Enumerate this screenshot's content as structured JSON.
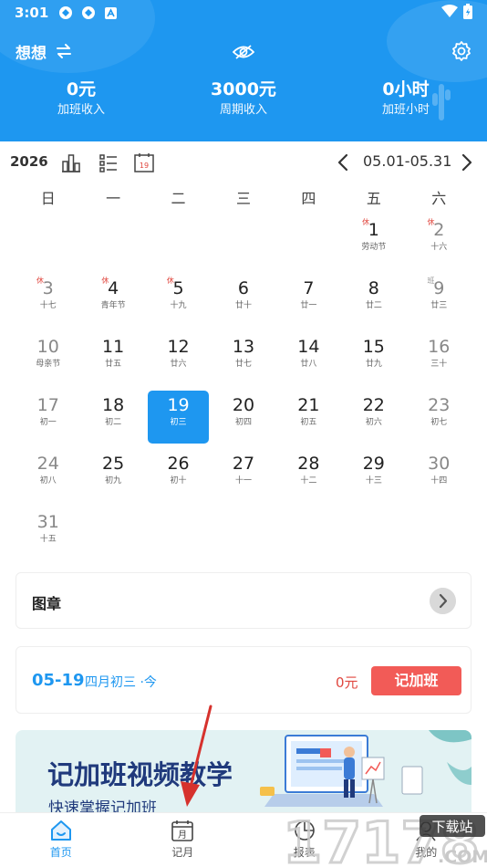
{
  "status_bar": {
    "time": "3:01"
  },
  "header": {
    "app_title": "想想",
    "stats": [
      {
        "value": "0元",
        "label": "加班收入"
      },
      {
        "value": "3000元",
        "label": "周期收入"
      },
      {
        "value": "0小时",
        "label": "加班小时"
      }
    ]
  },
  "toolbar": {
    "year": "2026",
    "range": "05.01-05.31"
  },
  "weekdays": [
    "日",
    "一",
    "二",
    "三",
    "四",
    "五",
    "六"
  ],
  "calendar": {
    "today_day": "19",
    "rows": [
      [
        {
          "day": "",
          "sub": ""
        },
        {
          "day": "",
          "sub": ""
        },
        {
          "day": "",
          "sub": ""
        },
        {
          "day": "",
          "sub": ""
        },
        {
          "day": "",
          "sub": ""
        },
        {
          "day": "1",
          "sub": "劳动节",
          "tag": "休"
        },
        {
          "day": "2",
          "sub": "十六",
          "tag": "休"
        }
      ],
      [
        {
          "day": "3",
          "sub": "十七",
          "tag": "休"
        },
        {
          "day": "4",
          "sub": "青年节",
          "tag": "休"
        },
        {
          "day": "5",
          "sub": "十九",
          "tag": "休"
        },
        {
          "day": "6",
          "sub": "廿十"
        },
        {
          "day": "7",
          "sub": "廿一"
        },
        {
          "day": "8",
          "sub": "廿二"
        },
        {
          "day": "9",
          "sub": "廿三",
          "tag": "班"
        }
      ],
      [
        {
          "day": "10",
          "sub": "母亲节"
        },
        {
          "day": "11",
          "sub": "廿五"
        },
        {
          "day": "12",
          "sub": "廿六"
        },
        {
          "day": "13",
          "sub": "廿七"
        },
        {
          "day": "14",
          "sub": "廿八"
        },
        {
          "day": "15",
          "sub": "廿九"
        },
        {
          "day": "16",
          "sub": "三十"
        }
      ],
      [
        {
          "day": "17",
          "sub": "初一"
        },
        {
          "day": "18",
          "sub": "初二"
        },
        {
          "day": "19",
          "sub": "初三"
        },
        {
          "day": "20",
          "sub": "初四"
        },
        {
          "day": "21",
          "sub": "初五"
        },
        {
          "day": "22",
          "sub": "初六"
        },
        {
          "day": "23",
          "sub": "初七"
        }
      ],
      [
        {
          "day": "24",
          "sub": "初八"
        },
        {
          "day": "25",
          "sub": "初九"
        },
        {
          "day": "26",
          "sub": "初十"
        },
        {
          "day": "27",
          "sub": "十一"
        },
        {
          "day": "28",
          "sub": "十二"
        },
        {
          "day": "29",
          "sub": "十三"
        },
        {
          "day": "30",
          "sub": "十四"
        }
      ],
      [
        {
          "day": "31",
          "sub": "十五"
        },
        {
          "day": "",
          "sub": ""
        },
        {
          "day": "",
          "sub": ""
        },
        {
          "day": "",
          "sub": ""
        },
        {
          "day": "",
          "sub": ""
        },
        {
          "day": "",
          "sub": ""
        },
        {
          "day": "",
          "sub": ""
        }
      ]
    ]
  },
  "stamp_card": {
    "title": "图章"
  },
  "record_card": {
    "date": "05-19",
    "lunar": "四月初三 ·今",
    "amount": "0元",
    "button": "记加班"
  },
  "banner": {
    "title": "记加班视频教学",
    "subtitle": "快速掌握记加班"
  },
  "bottom_nav": [
    {
      "label": "首页",
      "active": true
    },
    {
      "label": "记月",
      "calendar_text": "月"
    },
    {
      "label": "报表"
    },
    {
      "label": "我的"
    }
  ],
  "watermark": {
    "text": "17178",
    "badge": "下载站",
    "domain": ".COM"
  },
  "colors": {
    "primary": "#1e97f0",
    "accent_red": "#f25b57",
    "holiday_red": "#e0473f"
  }
}
